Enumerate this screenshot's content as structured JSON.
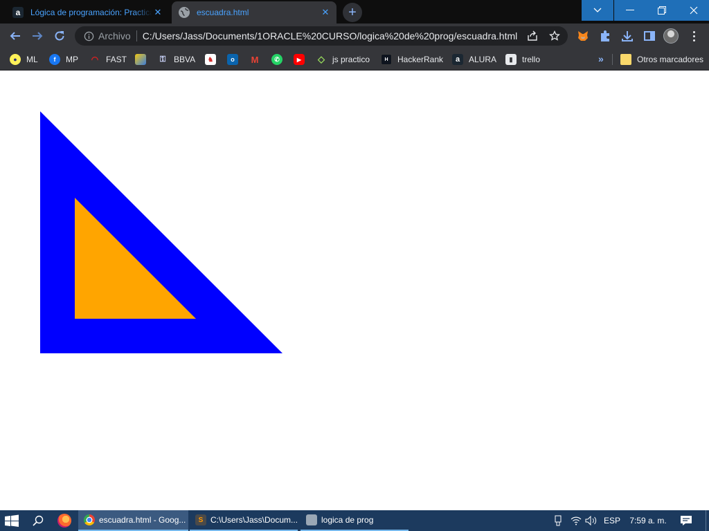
{
  "browser": {
    "tabs": [
      {
        "title": "Lógica de programación: Practica",
        "favicon": "alura-icon"
      },
      {
        "title": "escuadra.html",
        "favicon": "globe-icon",
        "active": true
      }
    ],
    "omnibox": {
      "scheme_label": "Archivo",
      "url": "C:/Users/Jass/Documents/1ORACLE%20CURSO/logica%20de%20prog/escuadra.html"
    },
    "accent_color": "#1f6fb8"
  },
  "bookmarks": {
    "items": [
      {
        "label": "ML",
        "icon": "mercadolibre-icon"
      },
      {
        "label": "MP",
        "icon": "facebook-icon"
      },
      {
        "label": "FAST",
        "icon": "fast-icon"
      },
      {
        "label": "",
        "icon": "powerbi-icon"
      },
      {
        "label": "BBVA",
        "icon": "bbva-icon"
      },
      {
        "label": "",
        "icon": "app-icon"
      },
      {
        "label": "",
        "icon": "outlook-icon"
      },
      {
        "label": "",
        "icon": "gmail-icon"
      },
      {
        "label": "",
        "icon": "whatsapp-icon"
      },
      {
        "label": "",
        "icon": "youtube-icon"
      },
      {
        "label": "js practico",
        "icon": "js-icon"
      },
      {
        "label": "HackerRank",
        "icon": "hackerrank-icon"
      },
      {
        "label": "ALURA",
        "icon": "alura-icon"
      },
      {
        "label": "trello",
        "icon": "trello-icon"
      }
    ],
    "other_folder": "Otros marcadores"
  },
  "canvas": {
    "outer_triangle_color": "#0000ff",
    "inner_triangle_color": "#ffa500",
    "background": "#ffffff"
  },
  "taskbar": {
    "apps": [
      {
        "label": "escuadra.html - Goog...",
        "icon": "chrome-icon",
        "active": true
      },
      {
        "label": "C:\\Users\\Jass\\Docum...",
        "icon": "sublime-icon"
      },
      {
        "label": "logica de prog",
        "icon": "folder-icon"
      }
    ],
    "language": "ESP",
    "clock": "7:59 a. m."
  }
}
